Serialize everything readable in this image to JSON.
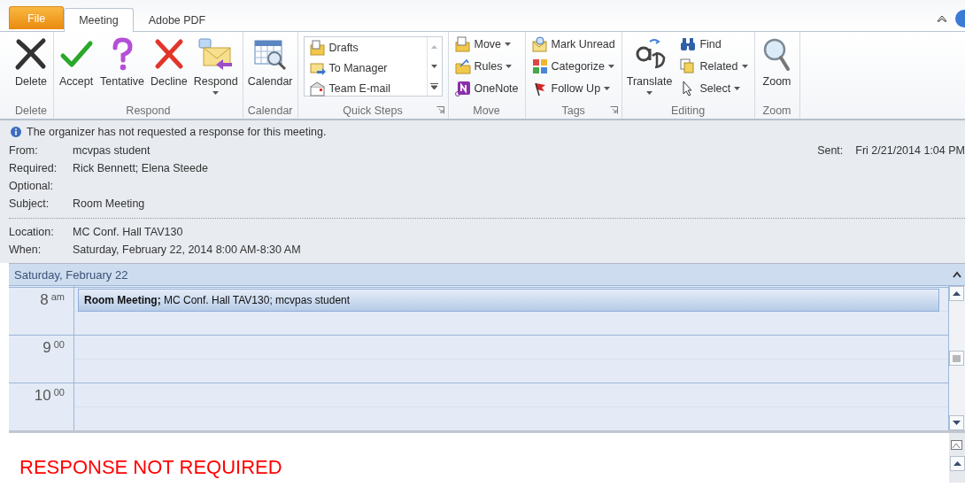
{
  "tabs": [
    {
      "label": "File",
      "kind": "file",
      "selected": false
    },
    {
      "label": "Meeting",
      "kind": "tab",
      "selected": true
    },
    {
      "label": "Adobe PDF",
      "kind": "tab",
      "selected": false
    }
  ],
  "ribbon": {
    "groups": [
      {
        "label": "Delete",
        "items": [
          {
            "kind": "large",
            "label": "Delete",
            "dropdown": false
          }
        ]
      },
      {
        "label": "Respond",
        "items": [
          {
            "kind": "large",
            "label": "Accept",
            "dropdown": false
          },
          {
            "kind": "large",
            "label": "Tentative",
            "dropdown": false
          },
          {
            "kind": "large",
            "label": "Decline",
            "dropdown": false
          },
          {
            "kind": "large",
            "label": "Respond",
            "dropdown": true
          }
        ]
      },
      {
        "label": "Calendar",
        "items": [
          {
            "kind": "large",
            "label": "Calendar",
            "dropdown": false
          }
        ]
      },
      {
        "label": "Quick Steps",
        "launcher": true,
        "items": [
          {
            "kind": "gallery",
            "label": "Drafts",
            "dropdown": false
          },
          {
            "kind": "gallery",
            "label": "To Manager",
            "dropdown": false
          },
          {
            "kind": "gallery",
            "label": "Team E-mail",
            "dropdown": false
          }
        ]
      },
      {
        "label": "Move",
        "items": [
          {
            "kind": "small",
            "label": "Move",
            "dropdown": true
          },
          {
            "kind": "small",
            "label": "Rules",
            "dropdown": true
          },
          {
            "kind": "small",
            "label": "OneNote",
            "dropdown": false
          }
        ]
      },
      {
        "label": "Tags",
        "launcher": true,
        "items": [
          {
            "kind": "small",
            "label": "Mark Unread",
            "dropdown": false
          },
          {
            "kind": "small",
            "label": "Categorize",
            "dropdown": true
          },
          {
            "kind": "small",
            "label": "Follow Up",
            "dropdown": true
          }
        ]
      },
      {
        "label": "Editing",
        "items": [
          {
            "kind": "large",
            "label": "Translate",
            "dropdown": true
          },
          {
            "kind": "small",
            "label": "Find",
            "dropdown": false
          },
          {
            "kind": "small",
            "label": "Related",
            "dropdown": true
          },
          {
            "kind": "small",
            "label": "Select",
            "dropdown": true
          }
        ]
      },
      {
        "label": "Zoom",
        "items": [
          {
            "kind": "large",
            "label": "Zoom",
            "dropdown": false
          }
        ]
      }
    ]
  },
  "info_bar": {
    "message": "The organizer has not requested a response for this meeting."
  },
  "header_fields": [
    {
      "label": "From:",
      "value": "mcvpas student"
    },
    {
      "label": "Required:",
      "value": "Rick Bennett; Elena Steede"
    },
    {
      "label": "Optional:"
    },
    {
      "label": "Subject:",
      "value": "Room Meeting"
    }
  ],
  "sent": {
    "label": "Sent:",
    "value": "Fri 2/21/2014 1:04 PM"
  },
  "meeting_fields": [
    {
      "label": "Location:",
      "value": "MC Conf. Hall TAV130"
    },
    {
      "label": "When:",
      "value": "Saturday, February 22, 2014 8:00 AM-8:30 AM"
    }
  ],
  "calendar": {
    "date": "Saturday, February 22",
    "slots": [
      {
        "hour": "8",
        "suffix": "am",
        "appointment": "**Room Meeting;** MC Conf. Hall TAV130; mcvpas student"
      },
      {
        "hour": "9",
        "suffix": "00"
      },
      {
        "hour": "10",
        "suffix": "00"
      }
    ]
  },
  "body": {
    "text": "RESPONSE NOT REQUIRED"
  }
}
